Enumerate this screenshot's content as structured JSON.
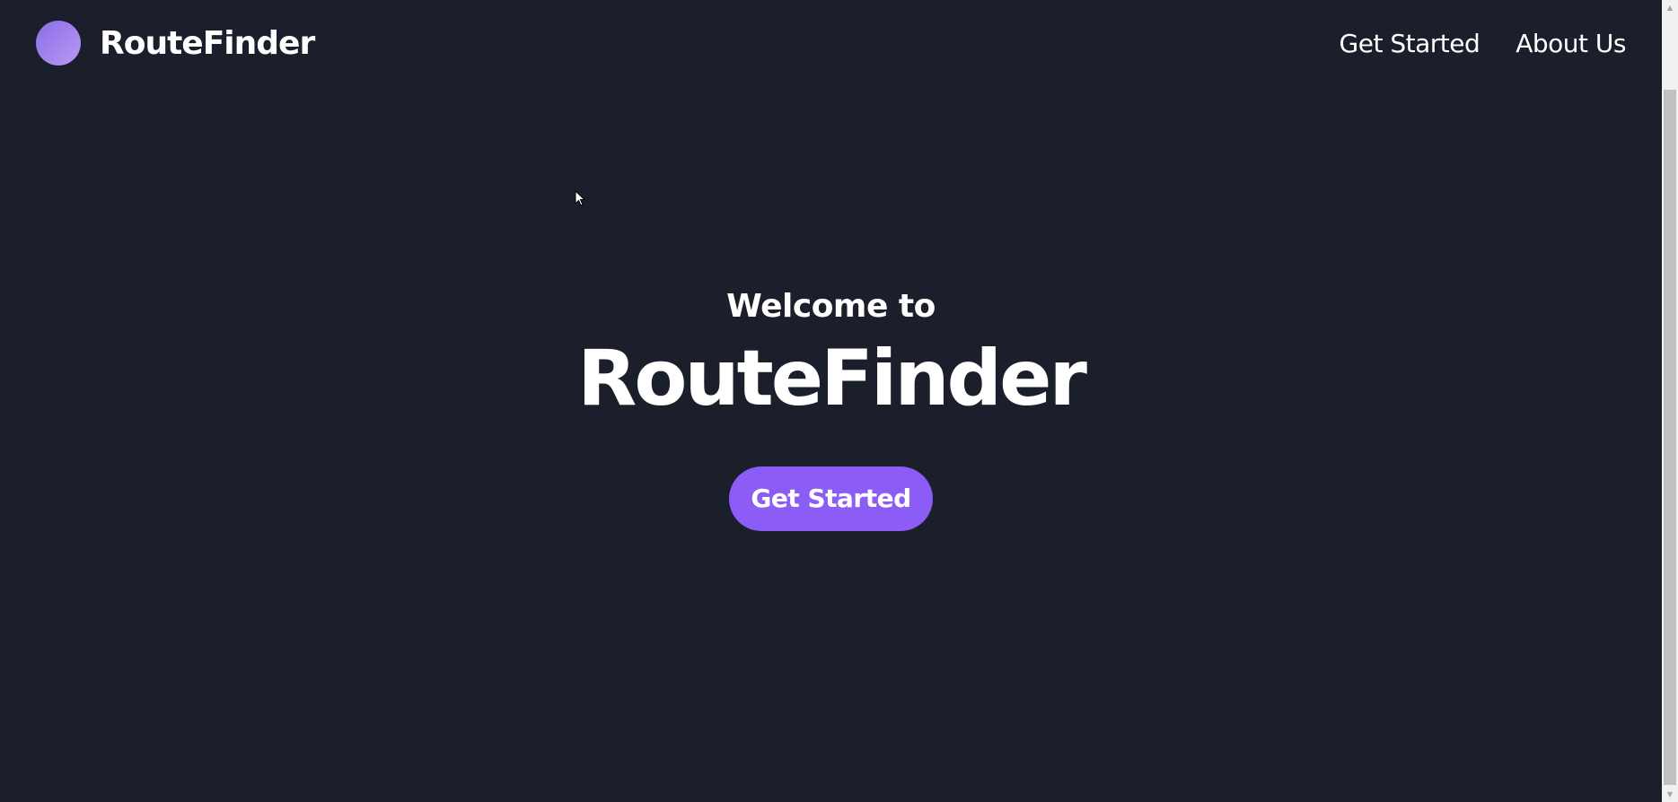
{
  "header": {
    "brand": "RouteFinder",
    "nav": {
      "get_started": "Get Started",
      "about_us": "About Us"
    }
  },
  "hero": {
    "welcome": "Welcome to",
    "title": "RouteFinder",
    "cta_label": "Get Started"
  },
  "colors": {
    "background": "#1b1f2b",
    "accent": "#8b5cf6",
    "logo_gradient_start": "#8b6ce8",
    "logo_gradient_end": "#b89af5",
    "text": "#ffffff"
  },
  "icons": {
    "logo": "logo-circle-icon",
    "cursor": "mouse-pointer-icon",
    "scroll_up": "chevron-up-icon",
    "scroll_down": "chevron-down-icon"
  }
}
